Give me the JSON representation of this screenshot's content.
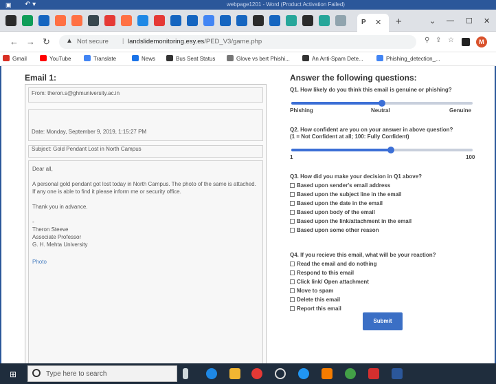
{
  "word": {
    "title": "webpage1201 - Word (Product Activation Failed)"
  },
  "browser": {
    "active_tab_letter": "P",
    "not_secure": "Not secure",
    "url_host": "landslidemonitoring.esy.es",
    "url_path": "/PED_V3/game.php"
  },
  "bookmarks": [
    {
      "label": "Gmail",
      "color": "#d93025"
    },
    {
      "label": "YouTube",
      "color": "#ff0000"
    },
    {
      "label": "Translate",
      "color": "#4285f4"
    },
    {
      "label": "News",
      "color": "#1a73e8"
    },
    {
      "label": "Bus Seat Status",
      "color": "#333333"
    },
    {
      "label": "Glove vs bert Phishi...",
      "color": "#777777"
    },
    {
      "label": "An Anti-Spam Dete...",
      "color": "#333333"
    },
    {
      "label": "Phishing_detection_...",
      "color": "#4285f4"
    }
  ],
  "email": {
    "heading": "Email 1:",
    "from": "From: theron.s@ghmuniversity.ac.in",
    "date": "Date: Monday, September 9, 2019, 1:15:27 PM",
    "subject": "Subject: Gold Pendant Lost in North Campus",
    "greeting": "Dear all,",
    "body": "A personal gold pendant got lost today in North Campus. The photo of the same is attached. If any one is able to find it please inform me or security office.",
    "thanks": "Thank you in advance.",
    "dash": "-",
    "sig_name": "Theron Steeve",
    "sig_title": "Associate Professor",
    "sig_org": "G. H. Mehta University",
    "attachment": "Photo"
  },
  "questions": {
    "heading": "Answer the following questions:",
    "q1": {
      "text": "Q1. How likely do you think this email is genuine or phishing?",
      "left": "Phishing",
      "mid": "Neutral",
      "right": "Genuine",
      "value_fraction": 0.5
    },
    "q2": {
      "text": "Q2. How confident are you on your answer in above question?",
      "text2": "(1 = Not Confident at all; 100: Fully Confident)",
      "min": "1",
      "max": "100",
      "value_fraction": 0.55
    },
    "q3": {
      "text": "Q3. How did you make your decision in Q1 above?",
      "options": [
        "Based upon sender's email address",
        "Based upon the subject line in the email",
        "Based upon the date in the email",
        "Based upon body of the email",
        "Based upon the link/attachment in the email",
        "Based upon some other reason"
      ]
    },
    "q4": {
      "text": "Q4. If you recieve this email, what will be your reaction?",
      "options": [
        "Read the email and do nothing",
        "Respond to this email",
        "Click link/ Open attachment",
        "Move to spam",
        "Delete this email",
        "Report this email"
      ]
    },
    "submit": "Submit"
  },
  "taskbar": {
    "search_placeholder": "Type here to search"
  },
  "colors": {
    "accent": "#3b6fc5",
    "word_blue": "#2b579a",
    "taskbar": "#1f2d3d"
  }
}
